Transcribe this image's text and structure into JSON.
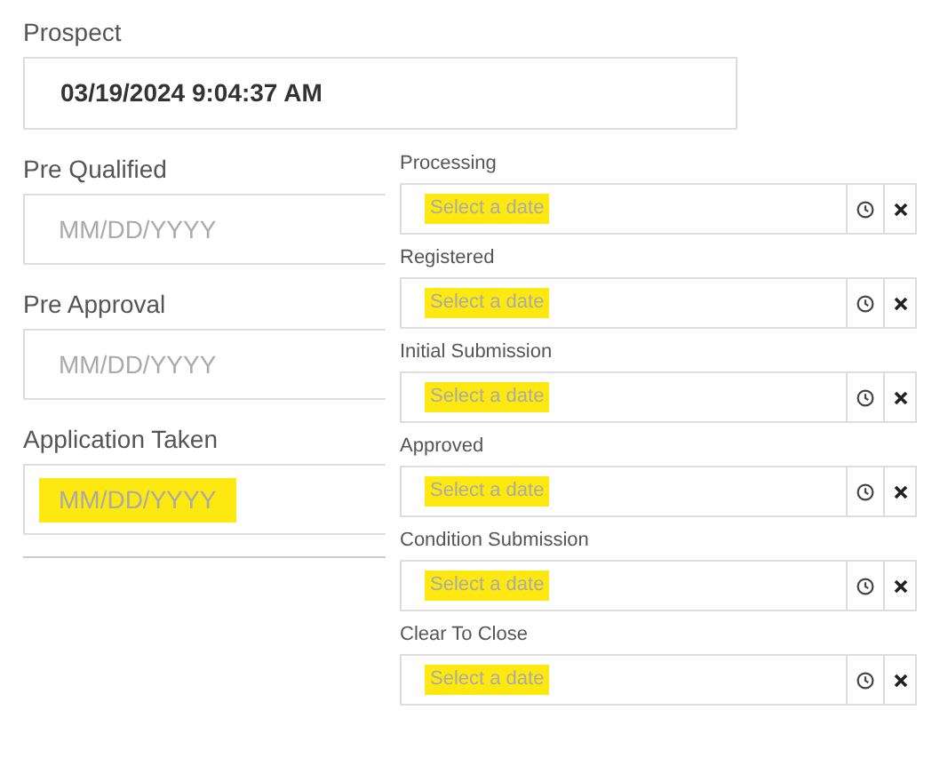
{
  "prospect": {
    "label": "Prospect",
    "value": "03/19/2024 9:04:37 AM"
  },
  "left_fields": [
    {
      "label": "Pre Qualified",
      "placeholder": "MM/DD/YYYY",
      "highlighted": false
    },
    {
      "label": "Pre Approval",
      "placeholder": "MM/DD/YYYY",
      "highlighted": false
    },
    {
      "label": "Application Taken",
      "placeholder": "MM/DD/YYYY",
      "highlighted": true
    }
  ],
  "date_pickers": [
    {
      "label": "Processing",
      "placeholder": "Select a date",
      "highlighted": true
    },
    {
      "label": "Registered",
      "placeholder": "Select a date",
      "highlighted": true
    },
    {
      "label": "Initial Submission",
      "placeholder": "Select a date",
      "highlighted": true
    },
    {
      "label": "Approved",
      "placeholder": "Select a date",
      "highlighted": true
    },
    {
      "label": "Condition Submission",
      "placeholder": "Select a date",
      "highlighted": true
    },
    {
      "label": "Clear To Close",
      "placeholder": "Select a date",
      "highlighted": true
    }
  ]
}
